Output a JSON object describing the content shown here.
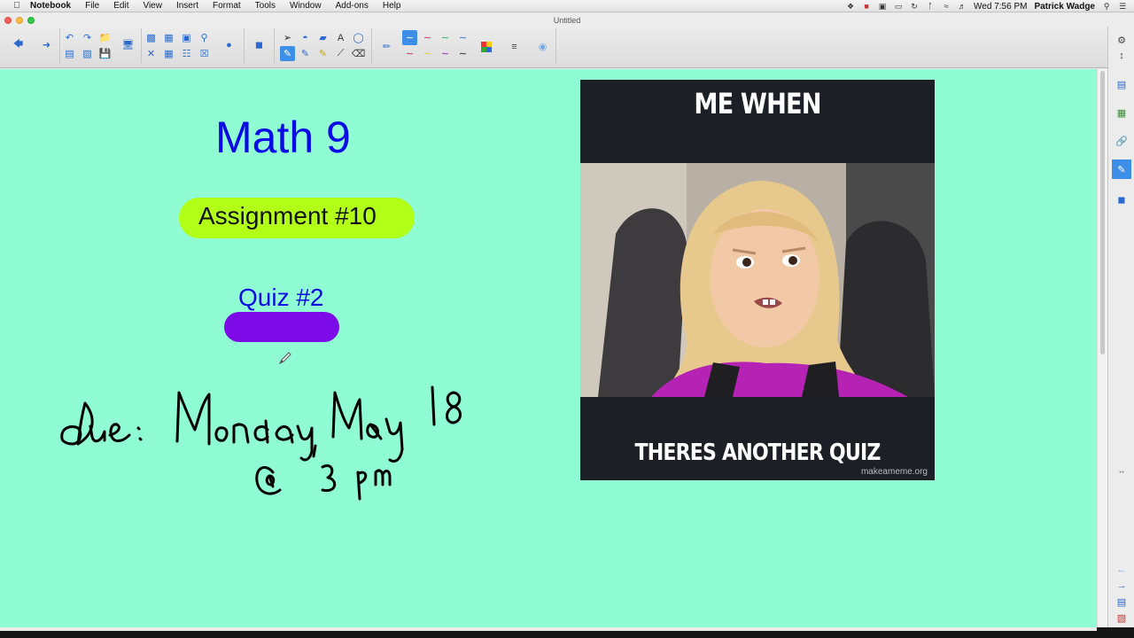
{
  "menubar": {
    "app_name": "Notebook",
    "items": [
      "File",
      "Edit",
      "View",
      "Insert",
      "Format",
      "Tools",
      "Window",
      "Add-ons",
      "Help"
    ],
    "clock": "Wed 7:56 PM",
    "user": "Patrick Wadge"
  },
  "window": {
    "title": "Untitled"
  },
  "toolbar": {
    "icons": [
      "back-arrow",
      "forward-arrow",
      "undo",
      "redo",
      "paste",
      "screen-shade",
      "insert-table",
      "capture",
      "document-camera",
      "delete",
      "select",
      "pens",
      "eraser",
      "text",
      "shapes",
      "pen-tool",
      "line-styles",
      "fill-color",
      "properties"
    ]
  },
  "canvas": {
    "background": "#8ffcd4",
    "title": "Math 9",
    "assignment": "Assignment #10",
    "quiz": "Quiz #2",
    "handwriting_line1": "due: Monday, May 18",
    "handwriting_line2": "@ 3 pm"
  },
  "meme": {
    "top_text": "ME WHEN",
    "bottom_text": "THERES ANOTHER QUIZ",
    "watermark": "makeameme.org"
  },
  "sidebar": {
    "tabs": [
      "page-sorter-icon",
      "gallery-icon",
      "attachments-icon",
      "properties-icon",
      "add-ons-icon"
    ]
  }
}
